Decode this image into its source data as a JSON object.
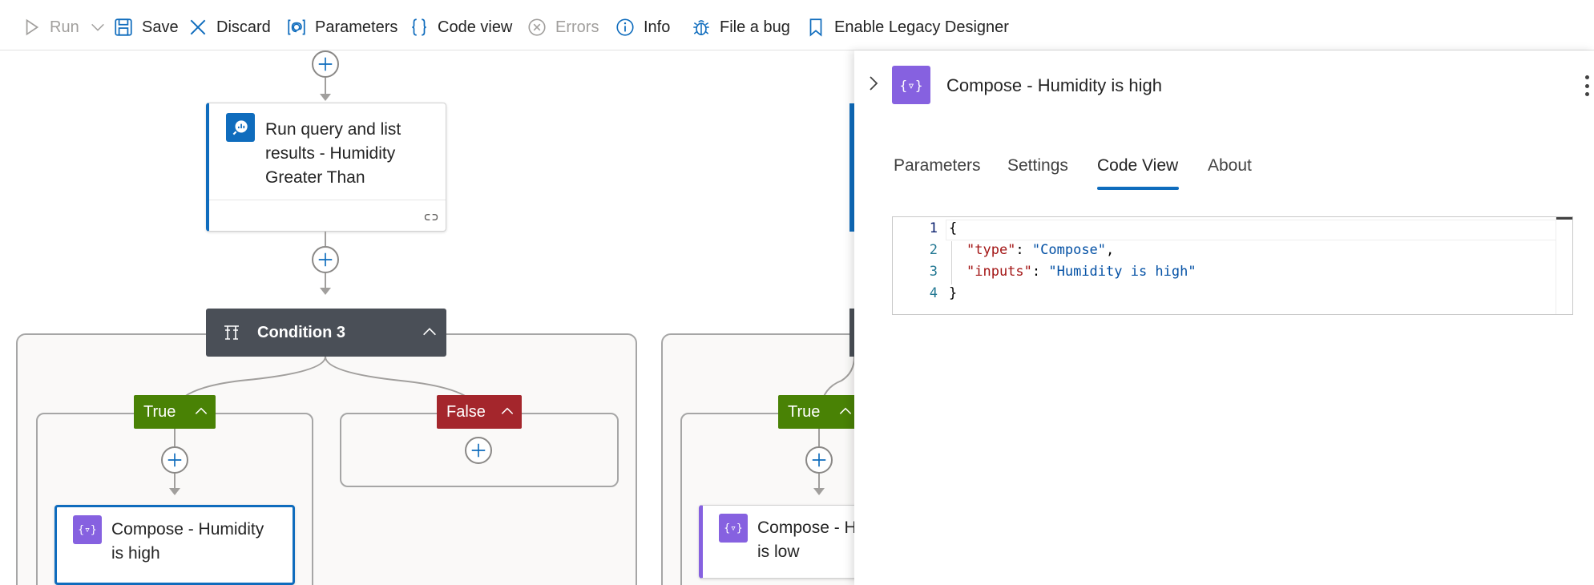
{
  "toolbar": {
    "run_label": "Run",
    "save_label": "Save",
    "discard_label": "Discard",
    "parameters_label": "Parameters",
    "code_view_label": "Code view",
    "errors_label": "Errors",
    "info_label": "Info",
    "file_bug_label": "File a bug",
    "legacy_label": "Enable Legacy Designer"
  },
  "canvas": {
    "query_action": {
      "title_line1": "Run query and list",
      "title_line2": "results - Humidity",
      "title_line3": "Greater Than"
    },
    "condition_title": "Condition 3",
    "true_label": "True",
    "false_label": "False",
    "true_label_right": "True",
    "compose_high": {
      "line1": "Compose - Humidity",
      "line2": "is high"
    },
    "compose_low": {
      "line1": "Compose - H",
      "line2": "is low"
    }
  },
  "panel": {
    "title": "Compose - Humidity is high",
    "tabs": [
      "Parameters",
      "Settings",
      "Code View",
      "About"
    ],
    "active_tab": "Code View",
    "code": {
      "line_numbers": [
        "1",
        "2",
        "3",
        "4"
      ],
      "line1": "{",
      "line2_key": "\"type\"",
      "line2_sep": ": ",
      "line2_val": "\"Compose\"",
      "line2_end": ",",
      "line3_key": "\"inputs\"",
      "line3_sep": ": ",
      "line3_val": "\"Humidity is high\"",
      "line4": "}"
    }
  },
  "colors": {
    "accent": "#0f6cbd",
    "true_green": "#498205",
    "false_red": "#a4262c",
    "compose_purple": "#8661e0",
    "condition_dark": "#4a4f57"
  }
}
